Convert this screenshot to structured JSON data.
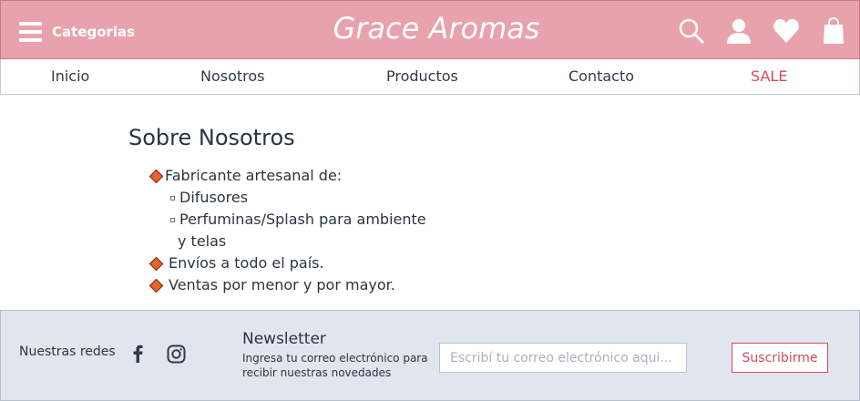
{
  "header": {
    "categories_label": "Categorias",
    "brand": "Grace Aromas",
    "icons": [
      "search-icon",
      "user-icon",
      "heart-icon",
      "shopping-bag-icon"
    ],
    "bg_color": "#e8a2ab"
  },
  "nav": {
    "items": [
      {
        "label": "Inicio"
      },
      {
        "label": "Nosotros"
      },
      {
        "label": "Productos"
      },
      {
        "label": "Contacto"
      },
      {
        "label": "SALE"
      }
    ],
    "sale_color": "#d5485f"
  },
  "main": {
    "title": "Sobre Nosotros",
    "bullet1": "Fabricante artesanal de:",
    "sub1": "Difusores",
    "sub2_line1": "Perfuminas/Splash para ambiente",
    "sub2_line2": "y telas",
    "bullet2": "Envíos a todo el país.",
    "bullet3": "Ventas por menor y por mayor.",
    "bullet_color": "#e8632d"
  },
  "footer": {
    "social_label": "Nuestras redes",
    "social_icons": [
      "facebook-icon",
      "instagram-icon"
    ],
    "newsletter_title": "Newsletter",
    "newsletter_desc": "Ingresa tu correo electrónico para recibir nuestras novedades",
    "email_placeholder": "Escribí tu correo electrónico aqui...",
    "subscribe_label": "Suscribirme",
    "bg_color": "#e1e6ee"
  }
}
